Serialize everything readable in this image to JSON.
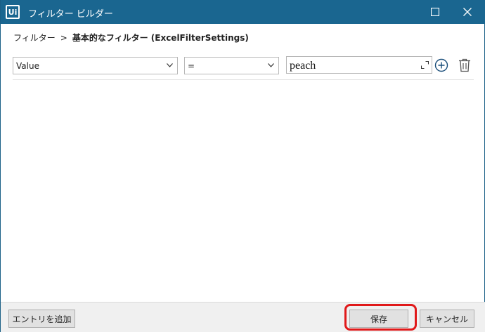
{
  "window": {
    "title": "フィルター ビルダー",
    "app_icon_text": "Ui"
  },
  "breadcrumb": {
    "root": "フィルター",
    "separator": ">",
    "current": "基本的なフィルター (ExcelFilterSettings)"
  },
  "filter_row": {
    "field_value": "Value",
    "operator_value": "=",
    "value_text": "peach"
  },
  "footer": {
    "add_entry_label": "エントリを追加",
    "save_label": "保存",
    "cancel_label": "キャンセル"
  },
  "colors": {
    "titlebar": "#1a6690",
    "highlight": "#e0191a"
  }
}
